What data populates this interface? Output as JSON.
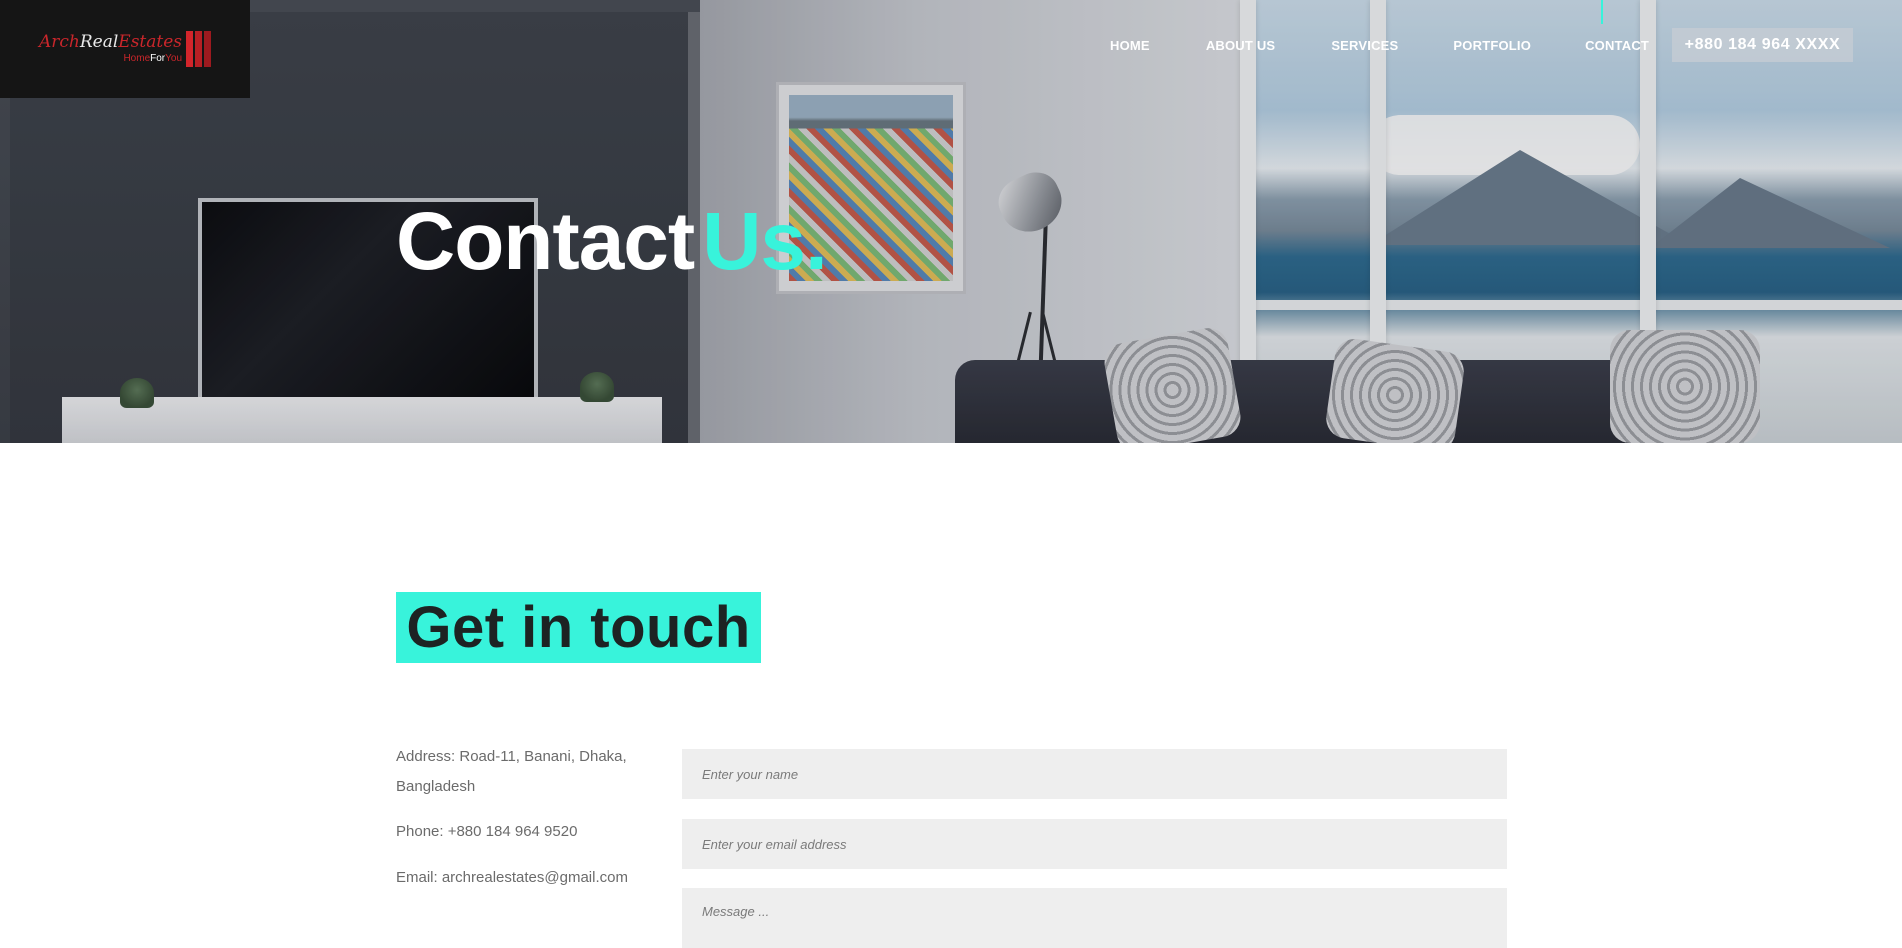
{
  "brand": {
    "logo_text_part1": "Arch",
    "logo_text_part2": "Real",
    "logo_text_part3": "Estates",
    "logo_sub_part1": "Home",
    "logo_sub_part2": "For",
    "logo_sub_part3": "You"
  },
  "nav": {
    "items": [
      {
        "label": "HOME"
      },
      {
        "label": "ABOUT US"
      },
      {
        "label": "SERVICES"
      },
      {
        "label": "PORTFOLIO"
      },
      {
        "label": "CONTACT",
        "active": true
      }
    ],
    "phone_button": "+880 184 964 XXXX"
  },
  "hero": {
    "title_part1": "Contact",
    "title_part2": "Us."
  },
  "contact": {
    "heading": "Get in touch",
    "address": "Address: Road-11, Banani, Dhaka, Bangladesh",
    "phone": "Phone: +880 184 964 9520",
    "email": "Email: archrealestates@gmail.com"
  },
  "form": {
    "name_placeholder": "Enter your name",
    "email_placeholder": "Enter your email address",
    "message_placeholder": "Message ..."
  },
  "colors": {
    "accent": "#38f3db",
    "logo_red": "#d3252b",
    "heading_text": "#1d2323",
    "field_bg": "#eeeeee"
  }
}
